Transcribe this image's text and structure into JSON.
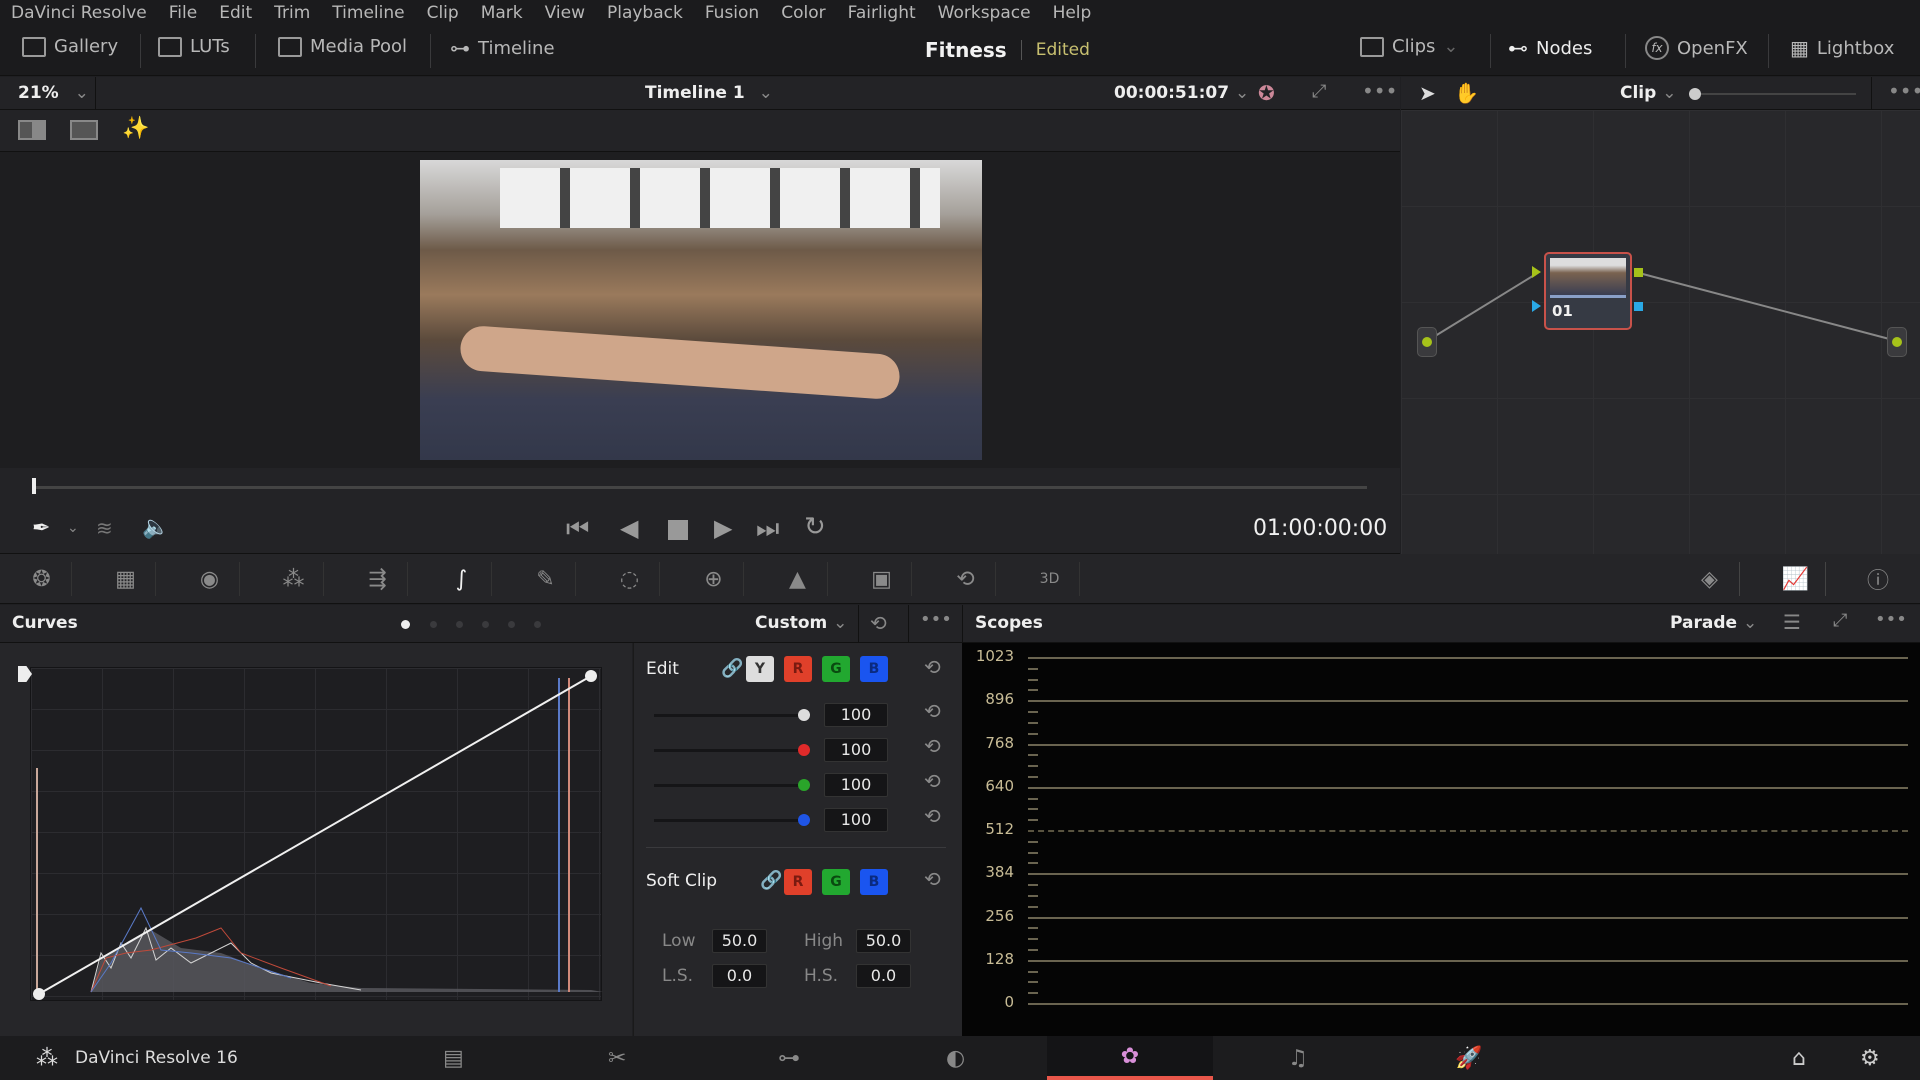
{
  "menu": [
    "DaVinci Resolve",
    "File",
    "Edit",
    "Trim",
    "Timeline",
    "Clip",
    "Mark",
    "View",
    "Playback",
    "Fusion",
    "Color",
    "Fairlight",
    "Workspace",
    "Help"
  ],
  "toolbar": {
    "left": [
      {
        "label": "Gallery",
        "icon": "gallery-icon"
      },
      {
        "label": "LUTs",
        "icon": "luts-icon"
      },
      {
        "label": "Media Pool",
        "icon": "media-pool-icon"
      },
      {
        "label": "Timeline",
        "icon": "timeline-icon"
      }
    ],
    "project_name": "Fitness",
    "project_status": "Edited",
    "right": [
      {
        "label": "Clips",
        "icon": "clips-icon"
      },
      {
        "label": "Nodes",
        "icon": "nodes-icon"
      },
      {
        "label": "OpenFX",
        "icon": "openfx-icon"
      },
      {
        "label": "Lightbox",
        "icon": "lightbox-icon"
      }
    ]
  },
  "viewer": {
    "zoom": "21%",
    "timeline_name": "Timeline 1",
    "timecode": "00:00:51:07",
    "current_timecode": "01:00:00:00",
    "playhead_fraction": 0.0
  },
  "nodes": {
    "mode": "Clip",
    "node_label": "01"
  },
  "curves": {
    "title": "Curves",
    "preset": "Custom",
    "edit_label": "Edit",
    "channels": [
      "Y",
      "R",
      "G",
      "B"
    ],
    "intensity": [
      {
        "channel": "Y",
        "value": "100",
        "color": "#dddddd"
      },
      {
        "channel": "R",
        "value": "100",
        "color": "#e02a2a"
      },
      {
        "channel": "G",
        "value": "100",
        "color": "#2aa52a"
      },
      {
        "channel": "B",
        "value": "100",
        "color": "#1f55e6"
      }
    ],
    "soft_clip_label": "Soft Clip",
    "soft_clip_channels": [
      "R",
      "G",
      "B"
    ],
    "low_label": "Low",
    "low": "50.0",
    "high_label": "High",
    "high": "50.0",
    "ls_label": "L.S.",
    "ls": "0.0",
    "hs_label": "H.S.",
    "hs": "0.0"
  },
  "scopes": {
    "title": "Scopes",
    "mode": "Parade",
    "ticks": [
      "1023",
      "896",
      "768",
      "640",
      "512",
      "384",
      "256",
      "128",
      "0"
    ]
  },
  "bottom": {
    "app_name": "DaVinci Resolve 16",
    "pages": [
      "media-page",
      "cut-page",
      "edit-page",
      "fusion-page",
      "color-page",
      "fairlight-page",
      "deliver-page"
    ],
    "active_page": "color-page"
  },
  "colors": {
    "accent": "#e8564a",
    "channel_r": "#e02a2a",
    "channel_g": "#2aa52a",
    "channel_b": "#1f55e6"
  }
}
